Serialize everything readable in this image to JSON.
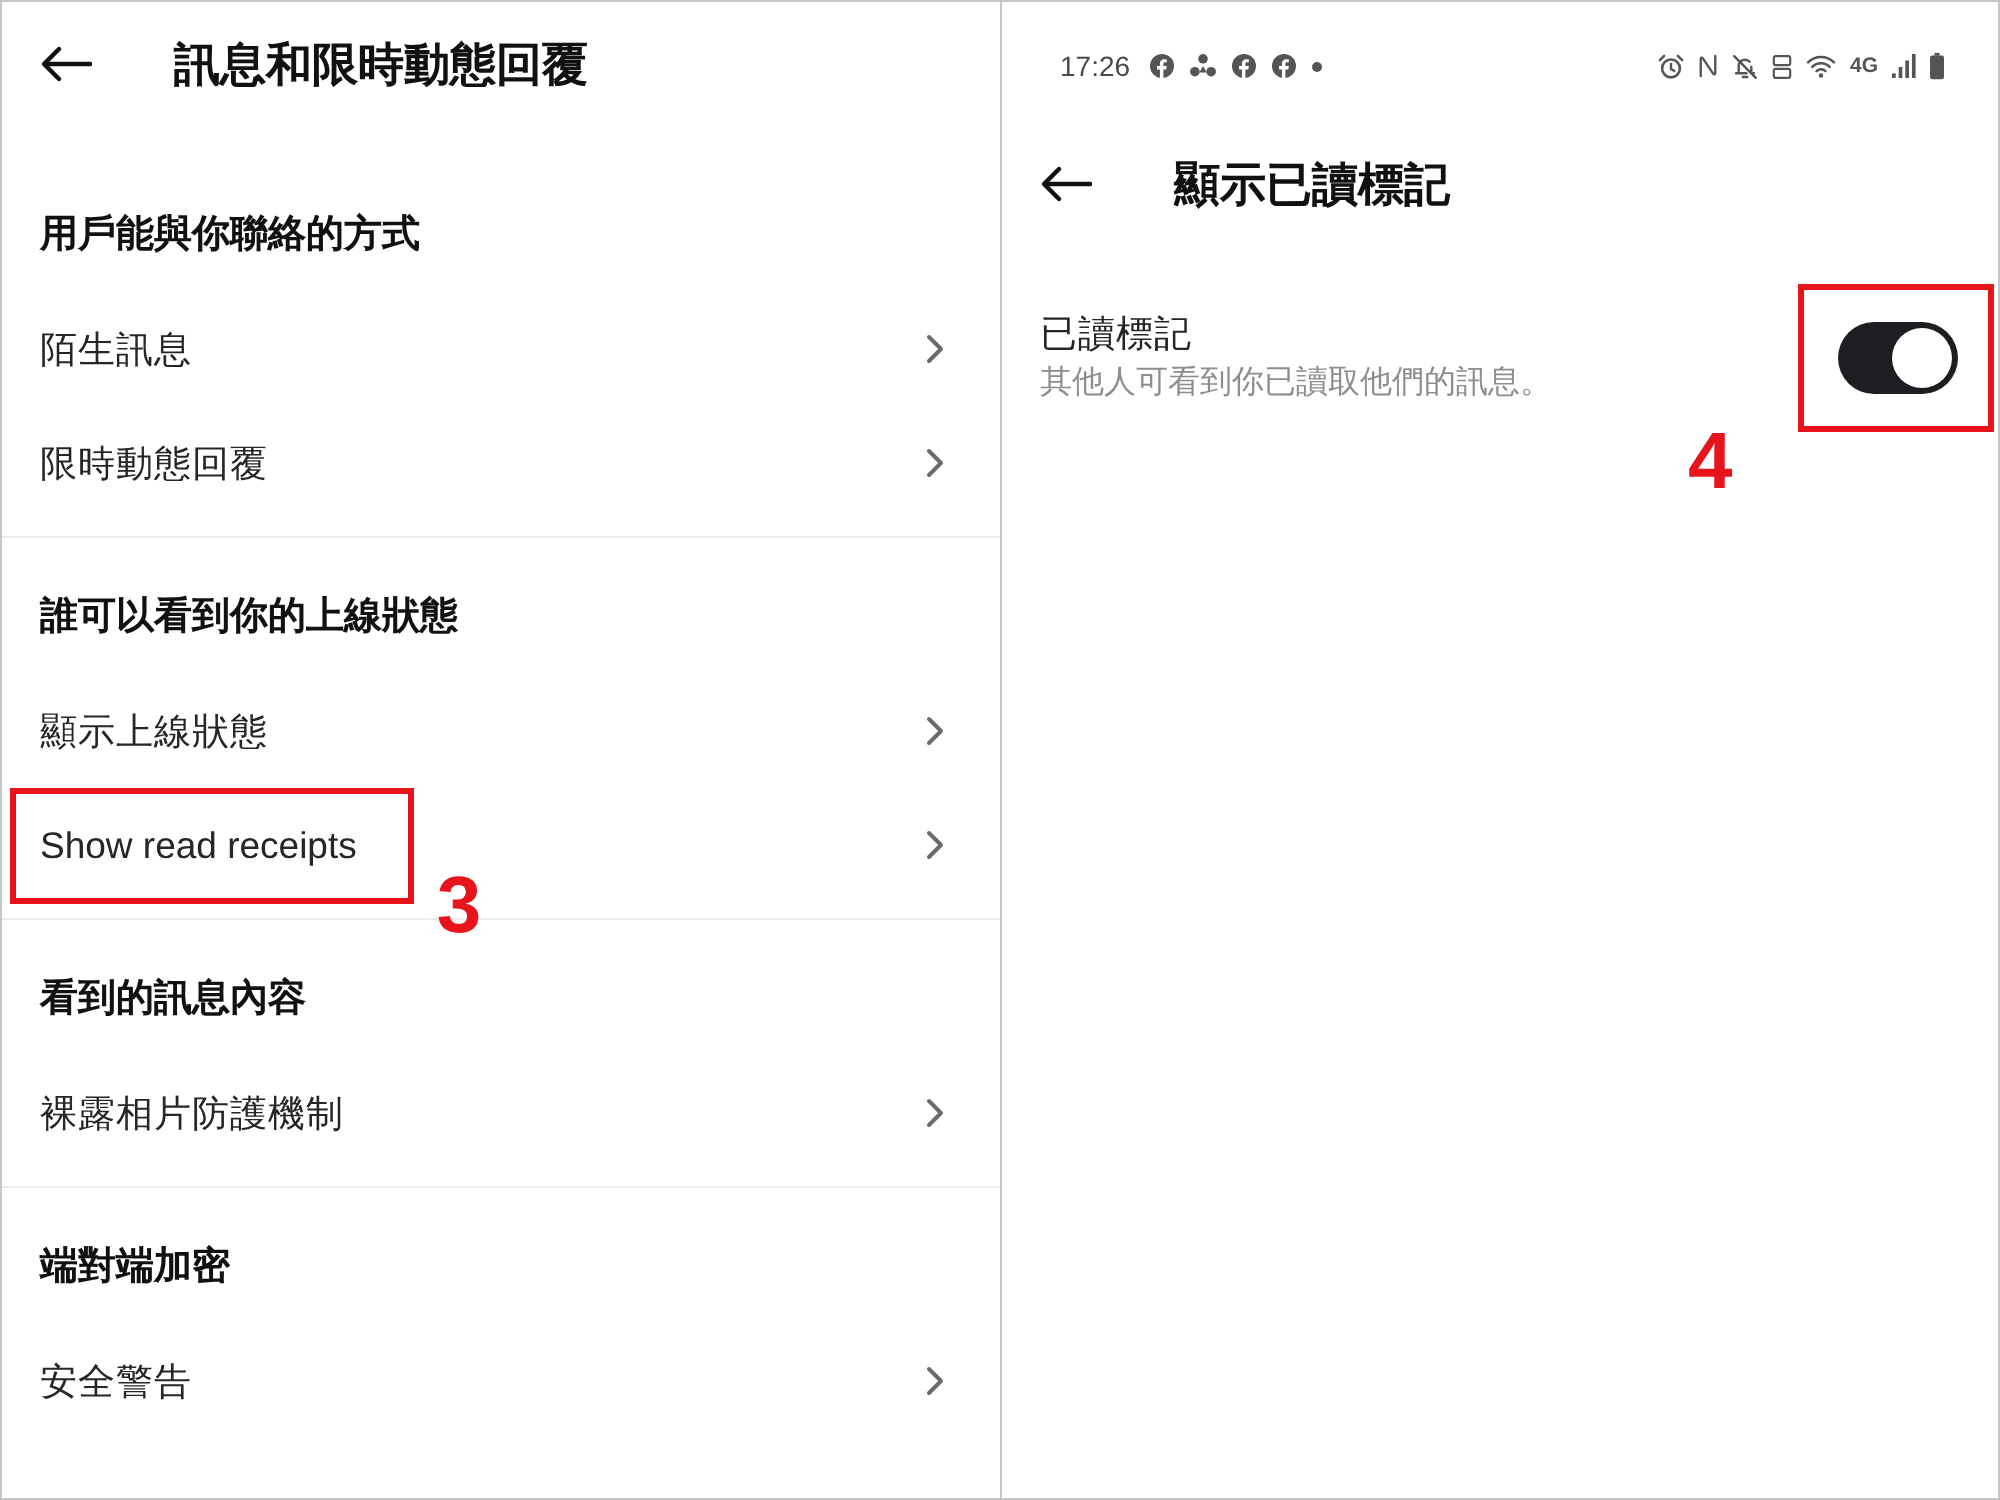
{
  "left_screen": {
    "header": {
      "title": "訊息和限時動態回覆"
    },
    "sections": [
      {
        "heading": "用戶能與你聯絡的方式",
        "items": [
          {
            "label": "陌生訊息",
            "highlighted": false
          },
          {
            "label": "限時動態回覆",
            "highlighted": false
          }
        ]
      },
      {
        "heading": "誰可以看到你的上線狀態",
        "items": [
          {
            "label": "顯示上線狀態",
            "highlighted": false
          },
          {
            "label": "Show read receipts",
            "highlighted": true,
            "callout": "3"
          }
        ]
      },
      {
        "heading": "看到的訊息內容",
        "items": [
          {
            "label": "裸露相片防護機制",
            "highlighted": false
          }
        ]
      },
      {
        "heading": "端對端加密",
        "items": [
          {
            "label": "安全警告",
            "highlighted": false
          }
        ]
      }
    ]
  },
  "right_screen": {
    "status_bar": {
      "time": "17:26",
      "network": "4G"
    },
    "header": {
      "title": "顯示已讀標記"
    },
    "setting": {
      "label": "已讀標記",
      "description": "其他人可看到你已讀取他們的訊息。",
      "on": true,
      "highlighted": true,
      "callout": "4"
    }
  }
}
